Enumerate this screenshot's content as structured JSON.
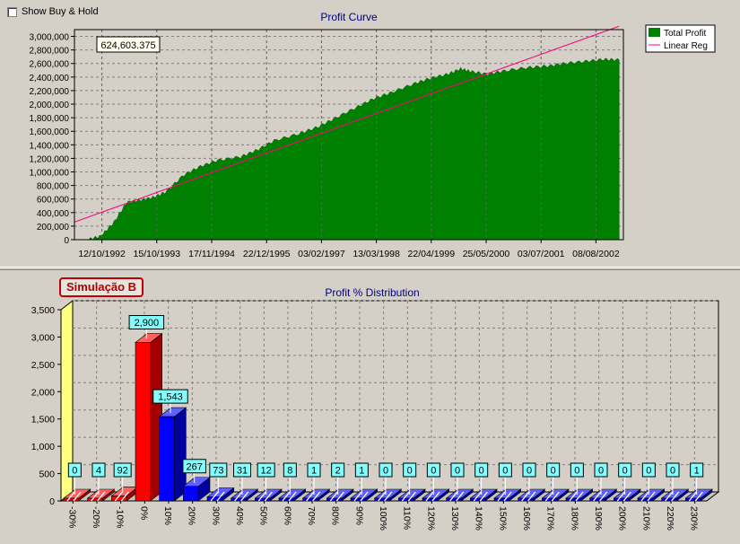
{
  "show_buy_hold": {
    "label": "Show Buy & Hold",
    "checked": false
  },
  "simulation_badge": "Simulação B",
  "colors": {
    "total_profit": "#008000",
    "linear_reg": "#ff0080",
    "negative_bar": "#ff0000",
    "positive_bar": "#0000ff",
    "label_box": "#80ffff",
    "title": "#000080"
  },
  "chart_data": [
    {
      "type": "area",
      "title": "Profit Curve",
      "annotation": "624,603.375",
      "legend": [
        "Total Profit",
        "Linear Reg"
      ],
      "legend_position": "top-right-outside",
      "grid": true,
      "ylim": [
        0,
        3100000
      ],
      "y_ticks": [
        0,
        200000,
        400000,
        600000,
        800000,
        1000000,
        1200000,
        1400000,
        1600000,
        1800000,
        2000000,
        2200000,
        2400000,
        2600000,
        2800000,
        3000000
      ],
      "y_tick_labels": [
        "0",
        "200,000",
        "400,000",
        "600,000",
        "800,000",
        "1,000,000",
        "1,200,000",
        "1,400,000",
        "1,600,000",
        "1,800,000",
        "2,000,000",
        "2,200,000",
        "2,400,000",
        "2,600,000",
        "2,800,000",
        "3,000,000"
      ],
      "x_tick_labels": [
        "12/10/1992",
        "15/10/1993",
        "17/11/1994",
        "22/12/1995",
        "03/02/1997",
        "13/03/1998",
        "22/04/1999",
        "25/05/2000",
        "03/07/2001",
        "08/08/2002"
      ],
      "xlim": [
        "1992-10-12",
        "2003-05-01"
      ],
      "series": [
        {
          "name": "Total Profit",
          "x": [
            "1992-10-12",
            "1993-01-15",
            "1993-04-15",
            "1993-07-15",
            "1993-10-15",
            "1994-01-15",
            "1994-04-15",
            "1994-07-15",
            "1994-11-17",
            "1995-03-15",
            "1995-07-15",
            "1995-12-22",
            "1996-04-15",
            "1996-08-15",
            "1997-02-03",
            "1997-06-15",
            "1997-10-15",
            "1998-03-13",
            "1998-07-15",
            "1998-11-15",
            "1999-04-22",
            "1999-08-15",
            "1999-12-15",
            "2000-03-15",
            "2000-05-25",
            "2000-09-15",
            "2001-01-15",
            "2001-07-03",
            "2001-11-15",
            "2002-03-15",
            "2002-08-08",
            "2002-12-15",
            "2003-04-01"
          ],
          "values": [
            0,
            0,
            50000,
            250000,
            550000,
            580000,
            620000,
            700000,
            950000,
            1080000,
            1170000,
            1220000,
            1320000,
            1460000,
            1560000,
            1660000,
            1790000,
            1950000,
            2080000,
            2170000,
            2300000,
            2380000,
            2440000,
            2520000,
            2480000,
            2440000,
            2490000,
            2540000,
            2560000,
            2600000,
            2630000,
            2660000,
            2650000
          ]
        },
        {
          "name": "Linear Reg",
          "x": [
            "1992-10-12",
            "2003-04-01"
          ],
          "values": [
            260000,
            3150000
          ]
        }
      ]
    },
    {
      "type": "bar",
      "title": "Profit % Distribution",
      "grid": true,
      "ylim": [
        0,
        3500
      ],
      "y_ticks": [
        0,
        500,
        1000,
        1500,
        2000,
        2500,
        3000,
        3500
      ],
      "y_tick_labels": [
        "0",
        "500",
        "1,000",
        "1,500",
        "2,000",
        "2,500",
        "3,000",
        "3,500"
      ],
      "categories": [
        "-30%",
        "-20%",
        "-10%",
        "0%",
        "10%",
        "20%",
        "30%",
        "40%",
        "50%",
        "60%",
        "70%",
        "80%",
        "90%",
        "100%",
        "110%",
        "120%",
        "130%",
        "140%",
        "150%",
        "160%",
        "170%",
        "180%",
        "190%",
        "200%",
        "210%",
        "220%",
        "230%"
      ],
      "values": [
        0,
        4,
        92,
        2900,
        1543,
        267,
        73,
        31,
        12,
        8,
        1,
        2,
        1,
        0,
        0,
        0,
        0,
        0,
        0,
        0,
        0,
        0,
        0,
        0,
        0,
        0,
        1
      ],
      "data_labels": [
        "0",
        "4",
        "92",
        "2,900",
        "1,543",
        "267",
        "73",
        "31",
        "12",
        "8",
        "1",
        "2",
        "1",
        "0",
        "0",
        "0",
        "0",
        "0",
        "0",
        "0",
        "0",
        "0",
        "0",
        "0",
        "0",
        "0",
        "1"
      ],
      "bar_colors": [
        "red",
        "red",
        "red",
        "red",
        "blue",
        "blue",
        "blue",
        "blue",
        "blue",
        "blue",
        "blue",
        "blue",
        "blue",
        "blue",
        "blue",
        "blue",
        "blue",
        "blue",
        "blue",
        "blue",
        "blue",
        "blue",
        "blue",
        "blue",
        "blue",
        "blue",
        "blue"
      ]
    }
  ]
}
